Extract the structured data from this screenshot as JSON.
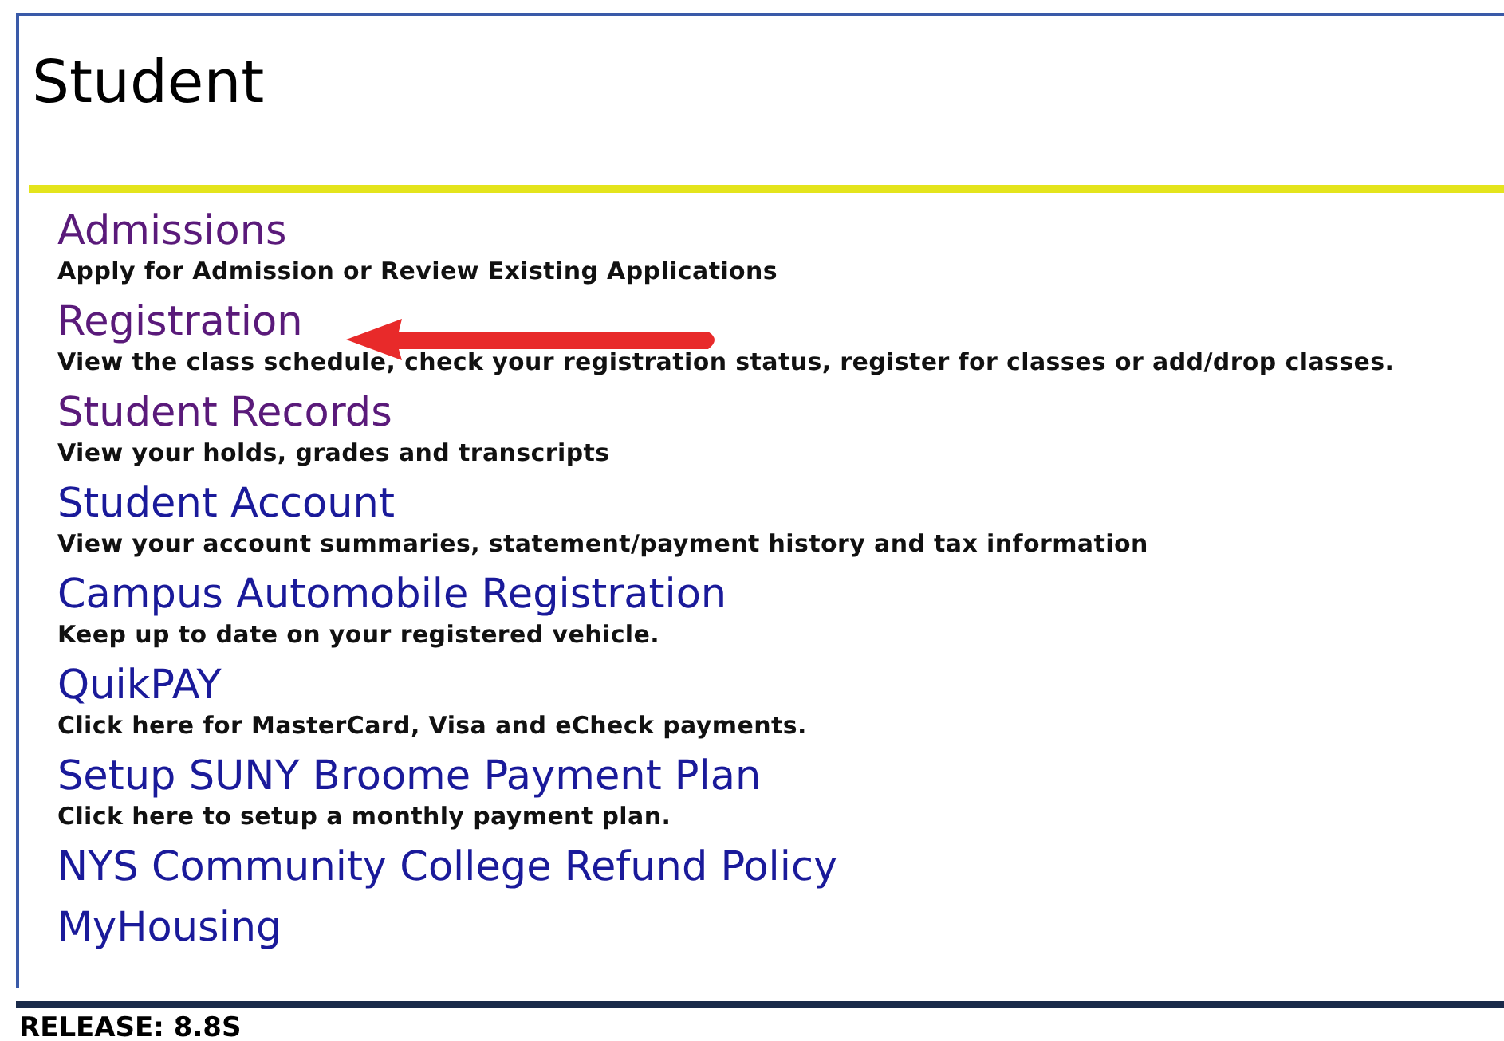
{
  "title": "Student",
  "links": [
    {
      "label": "Admissions",
      "description": "Apply for Admission or Review Existing Applications",
      "visited": true
    },
    {
      "label": "Registration",
      "description": "View the class schedule, check your registration status, register for classes or add/drop classes.",
      "visited": true
    },
    {
      "label": "Student Records",
      "description": "View your holds, grades and transcripts",
      "visited": true
    },
    {
      "label": "Student Account",
      "description": "View your account summaries, statement/payment history and tax information",
      "visited": false
    },
    {
      "label": "Campus Automobile Registration",
      "description": "Keep up to date on your registered vehicle.",
      "visited": false
    },
    {
      "label": "QuikPAY",
      "description": "Click here for MasterCard, Visa and eCheck payments.",
      "visited": false
    },
    {
      "label": "Setup SUNY Broome Payment Plan",
      "description": "Click here to setup a monthly payment plan.",
      "visited": false
    },
    {
      "label": "NYS Community College Refund Policy",
      "visited": false
    },
    {
      "label": "MyHousing",
      "visited": false
    }
  ],
  "release": "RELEASE: 8.8S"
}
